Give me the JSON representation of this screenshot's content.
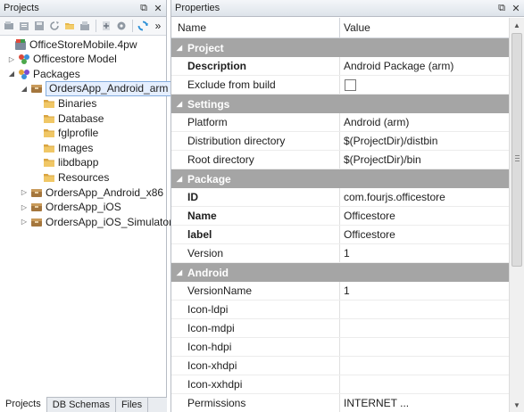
{
  "projects_panel": {
    "title": "Projects",
    "float_glyph": "⧉",
    "close_glyph": "✕",
    "overflow_glyph": "»",
    "tree": [
      {
        "label": "OfficeStoreMobile.4pw",
        "icon": "workspace-icon",
        "expand": ""
      },
      {
        "label": "Officestore Model",
        "icon": "model-icon",
        "expand": "▷"
      },
      {
        "label": "Packages",
        "icon": "packages-icon",
        "expand": "◢"
      },
      {
        "label": "OrdersApp_Android_arm",
        "icon": "package-icon",
        "expand": "◢"
      },
      {
        "label": "Binaries",
        "icon": "folder-icon",
        "expand": ""
      },
      {
        "label": "Database",
        "icon": "folder-icon",
        "expand": ""
      },
      {
        "label": "fglprofile",
        "icon": "folder-icon",
        "expand": ""
      },
      {
        "label": "Images",
        "icon": "folder-icon",
        "expand": ""
      },
      {
        "label": "libdbapp",
        "icon": "folder-icon",
        "expand": ""
      },
      {
        "label": "Resources",
        "icon": "folder-icon",
        "expand": ""
      },
      {
        "label": "OrdersApp_Android_x86",
        "icon": "package-icon",
        "expand": "▷"
      },
      {
        "label": "OrdersApp_iOS",
        "icon": "package-icon",
        "expand": "▷"
      },
      {
        "label": "OrdersApp_iOS_Simulator",
        "icon": "package-icon",
        "expand": "▷"
      }
    ],
    "tabs": [
      "Projects",
      "DB Schemas",
      "Files"
    ]
  },
  "properties_panel": {
    "title": "Properties",
    "col_name": "Name",
    "col_value": "Value",
    "group_glyph": "◢",
    "groups": [
      {
        "name": "Project",
        "props": [
          {
            "name": "Description",
            "value": "Android Package (arm)",
            "bold": true
          },
          {
            "name": "Exclude from build",
            "value": "",
            "checkbox": true
          }
        ]
      },
      {
        "name": "Settings",
        "props": [
          {
            "name": "Platform",
            "value": "Android (arm)"
          },
          {
            "name": "Distribution directory",
            "value": "$(ProjectDir)/distbin"
          },
          {
            "name": "Root directory",
            "value": "$(ProjectDir)/bin"
          }
        ]
      },
      {
        "name": "Package",
        "props": [
          {
            "name": "ID",
            "value": "com.fourjs.officestore",
            "bold": true
          },
          {
            "name": "Name",
            "value": "Officestore",
            "bold": true
          },
          {
            "name": "label",
            "value": "Officestore",
            "bold": true
          },
          {
            "name": "Version",
            "value": "1"
          }
        ]
      },
      {
        "name": "Android",
        "props": [
          {
            "name": "VersionName",
            "value": "1"
          },
          {
            "name": "Icon-ldpi",
            "value": ""
          },
          {
            "name": "Icon-mdpi",
            "value": ""
          },
          {
            "name": "Icon-hdpi",
            "value": ""
          },
          {
            "name": "Icon-xhdpi",
            "value": ""
          },
          {
            "name": "Icon-xxhdpi",
            "value": ""
          },
          {
            "name": "Permissions",
            "value": "INTERNET ..."
          }
        ]
      }
    ]
  },
  "scroll_up_glyph": "▲",
  "scroll_down_glyph": "▼"
}
